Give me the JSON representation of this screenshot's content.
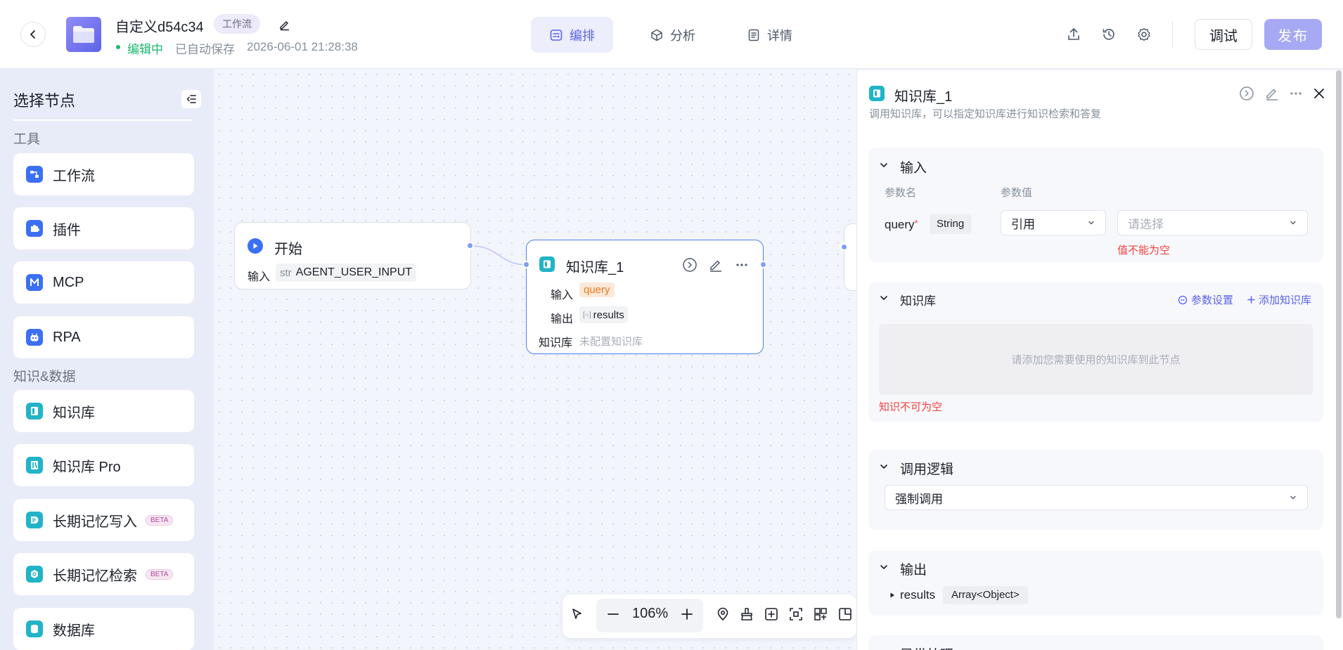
{
  "header": {
    "app_name": "自定义d54c34",
    "type_tag": "工作流",
    "status": "编辑中",
    "autosave": "已自动保存",
    "save_time": "2026-06-01 21:28:38",
    "tabs": [
      {
        "label": "编排",
        "icon": "arrange-icon",
        "active": true
      },
      {
        "label": "分析",
        "icon": "cube-icon",
        "active": false
      },
      {
        "label": "详情",
        "icon": "document-icon",
        "active": false
      }
    ],
    "debug_label": "调试",
    "publish_label": "发布"
  },
  "node_panel": {
    "title": "选择节点",
    "sections": [
      {
        "title": "工具",
        "items": [
          {
            "label": "工作流",
            "icon": "workflow-icon",
            "color": "#3b6ff5"
          },
          {
            "label": "插件",
            "icon": "plugin-icon",
            "color": "#3b6ff5"
          },
          {
            "label": "MCP",
            "icon": "mcp-icon",
            "color": "#3b6ff5"
          },
          {
            "label": "RPA",
            "icon": "robot-icon",
            "color": "#3b6ff5"
          }
        ]
      },
      {
        "title": "知识&数据",
        "items": [
          {
            "label": "知识库",
            "icon": "knowledge-base-icon",
            "color": "#21b4c8"
          },
          {
            "label": "知识库 Pro",
            "icon": "knowledge-base-pro-icon",
            "color": "#21b4c8"
          },
          {
            "label": "长期记忆写入",
            "icon": "memory-write-icon",
            "color": "#21b4c8",
            "badge": "BETA"
          },
          {
            "label": "长期记忆检索",
            "icon": "memory-search-icon",
            "color": "#21b4c8",
            "badge": "BETA"
          },
          {
            "label": "数据库",
            "icon": "database-icon",
            "color": "#21b4c8"
          }
        ]
      }
    ]
  },
  "canvas": {
    "start_node": {
      "title": "开始",
      "input_label": "输入",
      "input_type": "str",
      "input_value": "AGENT_USER_INPUT"
    },
    "kb_node": {
      "title": "知识库_1",
      "input_label": "输入",
      "input_value": "query",
      "output_label": "输出",
      "output_value": "results",
      "kb_label": "知识库",
      "kb_value": "未配置知识库"
    },
    "zoom": "106%"
  },
  "right_panel": {
    "title": "知识库_1",
    "description": "调用知识库，可以指定知识库进行知识检索和答复",
    "input_section": {
      "title": "输入",
      "col_name": "参数名",
      "col_value": "参数值",
      "param_name": "query",
      "required_mark": "*",
      "param_type": "String",
      "ref_mode": "引用",
      "select_placeholder": "请选择",
      "error": "值不能为空"
    },
    "kb_section": {
      "title": "知识库",
      "param_settings": "参数设置",
      "add_kb": "添加知识库",
      "empty_hint": "请添加您需要使用的知识库到此节点",
      "error": "知识不可为空"
    },
    "logic_section": {
      "title": "调用逻辑",
      "value": "强制调用"
    },
    "output_section": {
      "title": "输出",
      "param_name": "results",
      "param_type": "Array<Object>"
    },
    "exception_section": {
      "title": "异常处理"
    }
  },
  "colors": {
    "accent": "#5b63e6",
    "status_green": "#1fb66e",
    "error_red": "#f53f3f",
    "node_border_active": "#4a80f0"
  }
}
